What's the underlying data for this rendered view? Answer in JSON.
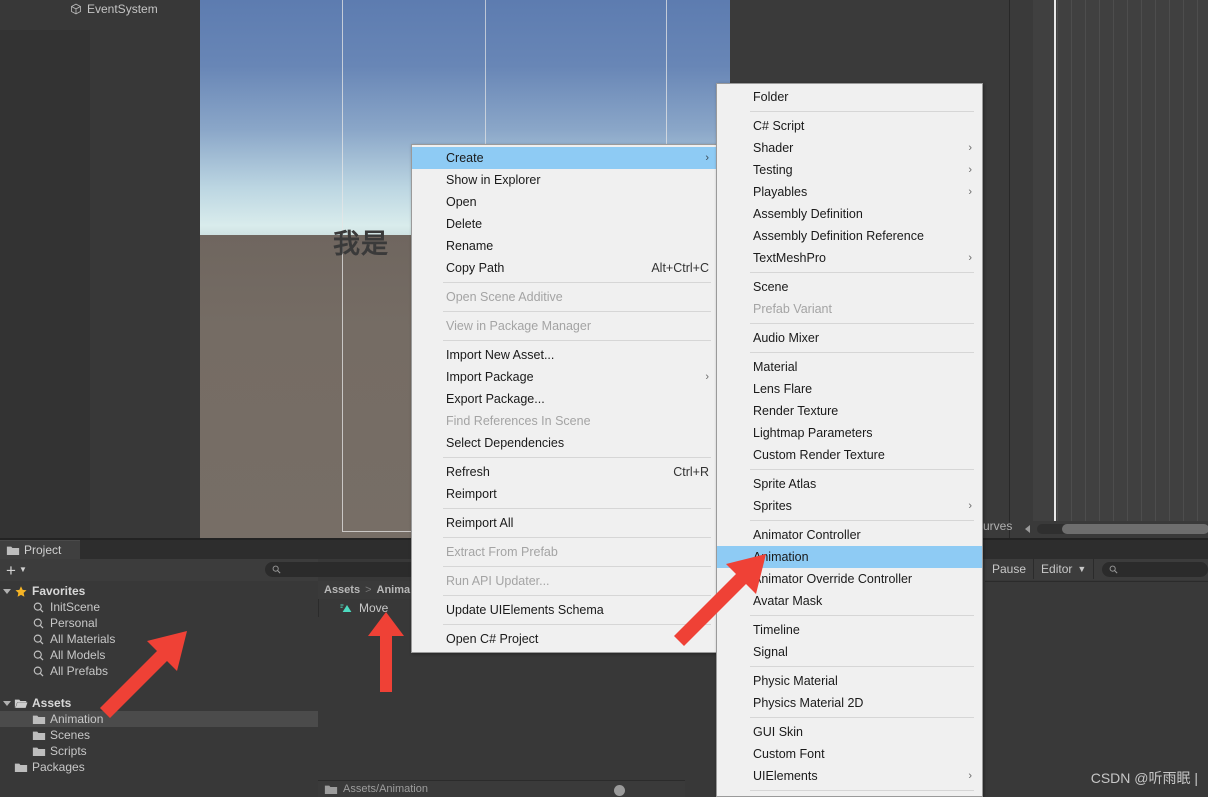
{
  "hierarchy": {
    "item_label": "EventSystem",
    "icon": "cube-icon"
  },
  "scene": {
    "overlay_text": "我是",
    "sky_color": "#5d7cb0",
    "ground_color": "#756c64"
  },
  "animation_window": {
    "curves_tab_label": "urves",
    "scroll_icon": "left-arrow-icon"
  },
  "console": {
    "pause_label": "Pause",
    "editor_label": "Editor",
    "dropdown_icon": "chevron-down-icon",
    "search_icon": "search-icon",
    "search_placeholder": ""
  },
  "watermark": {
    "text": "CSDN @听雨眠 |"
  },
  "project_panel": {
    "tab_label": "Project",
    "tab_icon": "folder-icon",
    "add_button_label": "+",
    "add_dropdown_icon": "chevron-down-icon",
    "search_icon": "search-icon",
    "search_value": "",
    "tree": [
      {
        "label": "Favorites",
        "icon": "star-icon",
        "indent": 0,
        "expander": "down",
        "selected": false,
        "bold": true
      },
      {
        "label": "InitScene",
        "icon": "search-icon",
        "indent": 1,
        "expander": "none",
        "selected": false,
        "bold": false
      },
      {
        "label": "Personal",
        "icon": "search-icon",
        "indent": 1,
        "expander": "none",
        "selected": false,
        "bold": false
      },
      {
        "label": "All Materials",
        "icon": "search-icon",
        "indent": 1,
        "expander": "none",
        "selected": false,
        "bold": false
      },
      {
        "label": "All Models",
        "icon": "search-icon",
        "indent": 1,
        "expander": "none",
        "selected": false,
        "bold": false
      },
      {
        "label": "All Prefabs",
        "icon": "search-icon",
        "indent": 1,
        "expander": "none",
        "selected": false,
        "bold": false
      },
      {
        "label": "",
        "icon": "none",
        "indent": 0,
        "expander": "none",
        "selected": false,
        "bold": false
      },
      {
        "label": "Assets",
        "icon": "folder-open-icon",
        "indent": 0,
        "expander": "down",
        "selected": false,
        "bold": true
      },
      {
        "label": "Animation",
        "icon": "folder-icon",
        "indent": 1,
        "expander": "none",
        "selected": true,
        "bold": false
      },
      {
        "label": "Scenes",
        "icon": "folder-icon",
        "indent": 1,
        "expander": "none",
        "selected": false,
        "bold": false
      },
      {
        "label": "Scripts",
        "icon": "folder-icon",
        "indent": 1,
        "expander": "none",
        "selected": false,
        "bold": false
      },
      {
        "label": "Packages",
        "icon": "folder-icon",
        "indent": 0,
        "expander": "none",
        "selected": false,
        "bold": false
      }
    ],
    "breadcrumb": {
      "root": "Assets",
      "separator": ">",
      "current": "Anima"
    },
    "content_item": {
      "label": "Move",
      "icon": "animation-clip-icon"
    },
    "status_path": "Assets/Animation",
    "status_icon": "folder-icon"
  },
  "context_menu": {
    "items": [
      {
        "label": "Create",
        "shortcut": "",
        "submenu": true,
        "disabled": false,
        "highlight": true,
        "sep_after": false
      },
      {
        "label": "Show in Explorer",
        "shortcut": "",
        "submenu": false,
        "disabled": false,
        "highlight": false,
        "sep_after": false
      },
      {
        "label": "Open",
        "shortcut": "",
        "submenu": false,
        "disabled": false,
        "highlight": false,
        "sep_after": false
      },
      {
        "label": "Delete",
        "shortcut": "",
        "submenu": false,
        "disabled": false,
        "highlight": false,
        "sep_after": false
      },
      {
        "label": "Rename",
        "shortcut": "",
        "submenu": false,
        "disabled": false,
        "highlight": false,
        "sep_after": false
      },
      {
        "label": "Copy Path",
        "shortcut": "Alt+Ctrl+C",
        "submenu": false,
        "disabled": false,
        "highlight": false,
        "sep_after": true
      },
      {
        "label": "Open Scene Additive",
        "shortcut": "",
        "submenu": false,
        "disabled": true,
        "highlight": false,
        "sep_after": true
      },
      {
        "label": "View in Package Manager",
        "shortcut": "",
        "submenu": false,
        "disabled": true,
        "highlight": false,
        "sep_after": true
      },
      {
        "label": "Import New Asset...",
        "shortcut": "",
        "submenu": false,
        "disabled": false,
        "highlight": false,
        "sep_after": false
      },
      {
        "label": "Import Package",
        "shortcut": "",
        "submenu": true,
        "disabled": false,
        "highlight": false,
        "sep_after": false
      },
      {
        "label": "Export Package...",
        "shortcut": "",
        "submenu": false,
        "disabled": false,
        "highlight": false,
        "sep_after": false
      },
      {
        "label": "Find References In Scene",
        "shortcut": "",
        "submenu": false,
        "disabled": true,
        "highlight": false,
        "sep_after": false
      },
      {
        "label": "Select Dependencies",
        "shortcut": "",
        "submenu": false,
        "disabled": false,
        "highlight": false,
        "sep_after": true
      },
      {
        "label": "Refresh",
        "shortcut": "Ctrl+R",
        "submenu": false,
        "disabled": false,
        "highlight": false,
        "sep_after": false
      },
      {
        "label": "Reimport",
        "shortcut": "",
        "submenu": false,
        "disabled": false,
        "highlight": false,
        "sep_after": true
      },
      {
        "label": "Reimport All",
        "shortcut": "",
        "submenu": false,
        "disabled": false,
        "highlight": false,
        "sep_after": true
      },
      {
        "label": "Extract From Prefab",
        "shortcut": "",
        "submenu": false,
        "disabled": true,
        "highlight": false,
        "sep_after": true
      },
      {
        "label": "Run API Updater...",
        "shortcut": "",
        "submenu": false,
        "disabled": true,
        "highlight": false,
        "sep_after": true
      },
      {
        "label": "Update UIElements Schema",
        "shortcut": "",
        "submenu": false,
        "disabled": false,
        "highlight": false,
        "sep_after": true
      },
      {
        "label": "Open C# Project",
        "shortcut": "",
        "submenu": false,
        "disabled": false,
        "highlight": false,
        "sep_after": false
      }
    ]
  },
  "create_submenu": {
    "items": [
      {
        "label": "Folder",
        "submenu": false,
        "disabled": false,
        "highlight": false,
        "sep_after": true
      },
      {
        "label": "C# Script",
        "submenu": false,
        "disabled": false,
        "highlight": false,
        "sep_after": false
      },
      {
        "label": "Shader",
        "submenu": true,
        "disabled": false,
        "highlight": false,
        "sep_after": false
      },
      {
        "label": "Testing",
        "submenu": true,
        "disabled": false,
        "highlight": false,
        "sep_after": false
      },
      {
        "label": "Playables",
        "submenu": true,
        "disabled": false,
        "highlight": false,
        "sep_after": false
      },
      {
        "label": "Assembly Definition",
        "submenu": false,
        "disabled": false,
        "highlight": false,
        "sep_after": false
      },
      {
        "label": "Assembly Definition Reference",
        "submenu": false,
        "disabled": false,
        "highlight": false,
        "sep_after": false
      },
      {
        "label": "TextMeshPro",
        "submenu": true,
        "disabled": false,
        "highlight": false,
        "sep_after": true
      },
      {
        "label": "Scene",
        "submenu": false,
        "disabled": false,
        "highlight": false,
        "sep_after": false
      },
      {
        "label": "Prefab Variant",
        "submenu": false,
        "disabled": true,
        "highlight": false,
        "sep_after": true
      },
      {
        "label": "Audio Mixer",
        "submenu": false,
        "disabled": false,
        "highlight": false,
        "sep_after": true
      },
      {
        "label": "Material",
        "submenu": false,
        "disabled": false,
        "highlight": false,
        "sep_after": false
      },
      {
        "label": "Lens Flare",
        "submenu": false,
        "disabled": false,
        "highlight": false,
        "sep_after": false
      },
      {
        "label": "Render Texture",
        "submenu": false,
        "disabled": false,
        "highlight": false,
        "sep_after": false
      },
      {
        "label": "Lightmap Parameters",
        "submenu": false,
        "disabled": false,
        "highlight": false,
        "sep_after": false
      },
      {
        "label": "Custom Render Texture",
        "submenu": false,
        "disabled": false,
        "highlight": false,
        "sep_after": true
      },
      {
        "label": "Sprite Atlas",
        "submenu": false,
        "disabled": false,
        "highlight": false,
        "sep_after": false
      },
      {
        "label": "Sprites",
        "submenu": true,
        "disabled": false,
        "highlight": false,
        "sep_after": true
      },
      {
        "label": "Animator Controller",
        "submenu": false,
        "disabled": false,
        "highlight": false,
        "sep_after": false
      },
      {
        "label": "Animation",
        "submenu": false,
        "disabled": false,
        "highlight": true,
        "sep_after": false
      },
      {
        "label": "Animator Override Controller",
        "submenu": false,
        "disabled": false,
        "highlight": false,
        "sep_after": false
      },
      {
        "label": "Avatar Mask",
        "submenu": false,
        "disabled": false,
        "highlight": false,
        "sep_after": true
      },
      {
        "label": "Timeline",
        "submenu": false,
        "disabled": false,
        "highlight": false,
        "sep_after": false
      },
      {
        "label": "Signal",
        "submenu": false,
        "disabled": false,
        "highlight": false,
        "sep_after": true
      },
      {
        "label": "Physic Material",
        "submenu": false,
        "disabled": false,
        "highlight": false,
        "sep_after": false
      },
      {
        "label": "Physics Material 2D",
        "submenu": false,
        "disabled": false,
        "highlight": false,
        "sep_after": true
      },
      {
        "label": "GUI Skin",
        "submenu": false,
        "disabled": false,
        "highlight": false,
        "sep_after": false
      },
      {
        "label": "Custom Font",
        "submenu": false,
        "disabled": false,
        "highlight": false,
        "sep_after": false
      },
      {
        "label": "UIElements",
        "submenu": true,
        "disabled": false,
        "highlight": false,
        "sep_after": true
      }
    ],
    "submenu_glyph": "›"
  },
  "annotations": {
    "arrow_color": "#ef4136",
    "arrows": [
      {
        "name": "arrow-to-animation-menu-item"
      },
      {
        "name": "arrow-to-animation-folder"
      },
      {
        "name": "arrow-to-move-clip"
      }
    ]
  }
}
